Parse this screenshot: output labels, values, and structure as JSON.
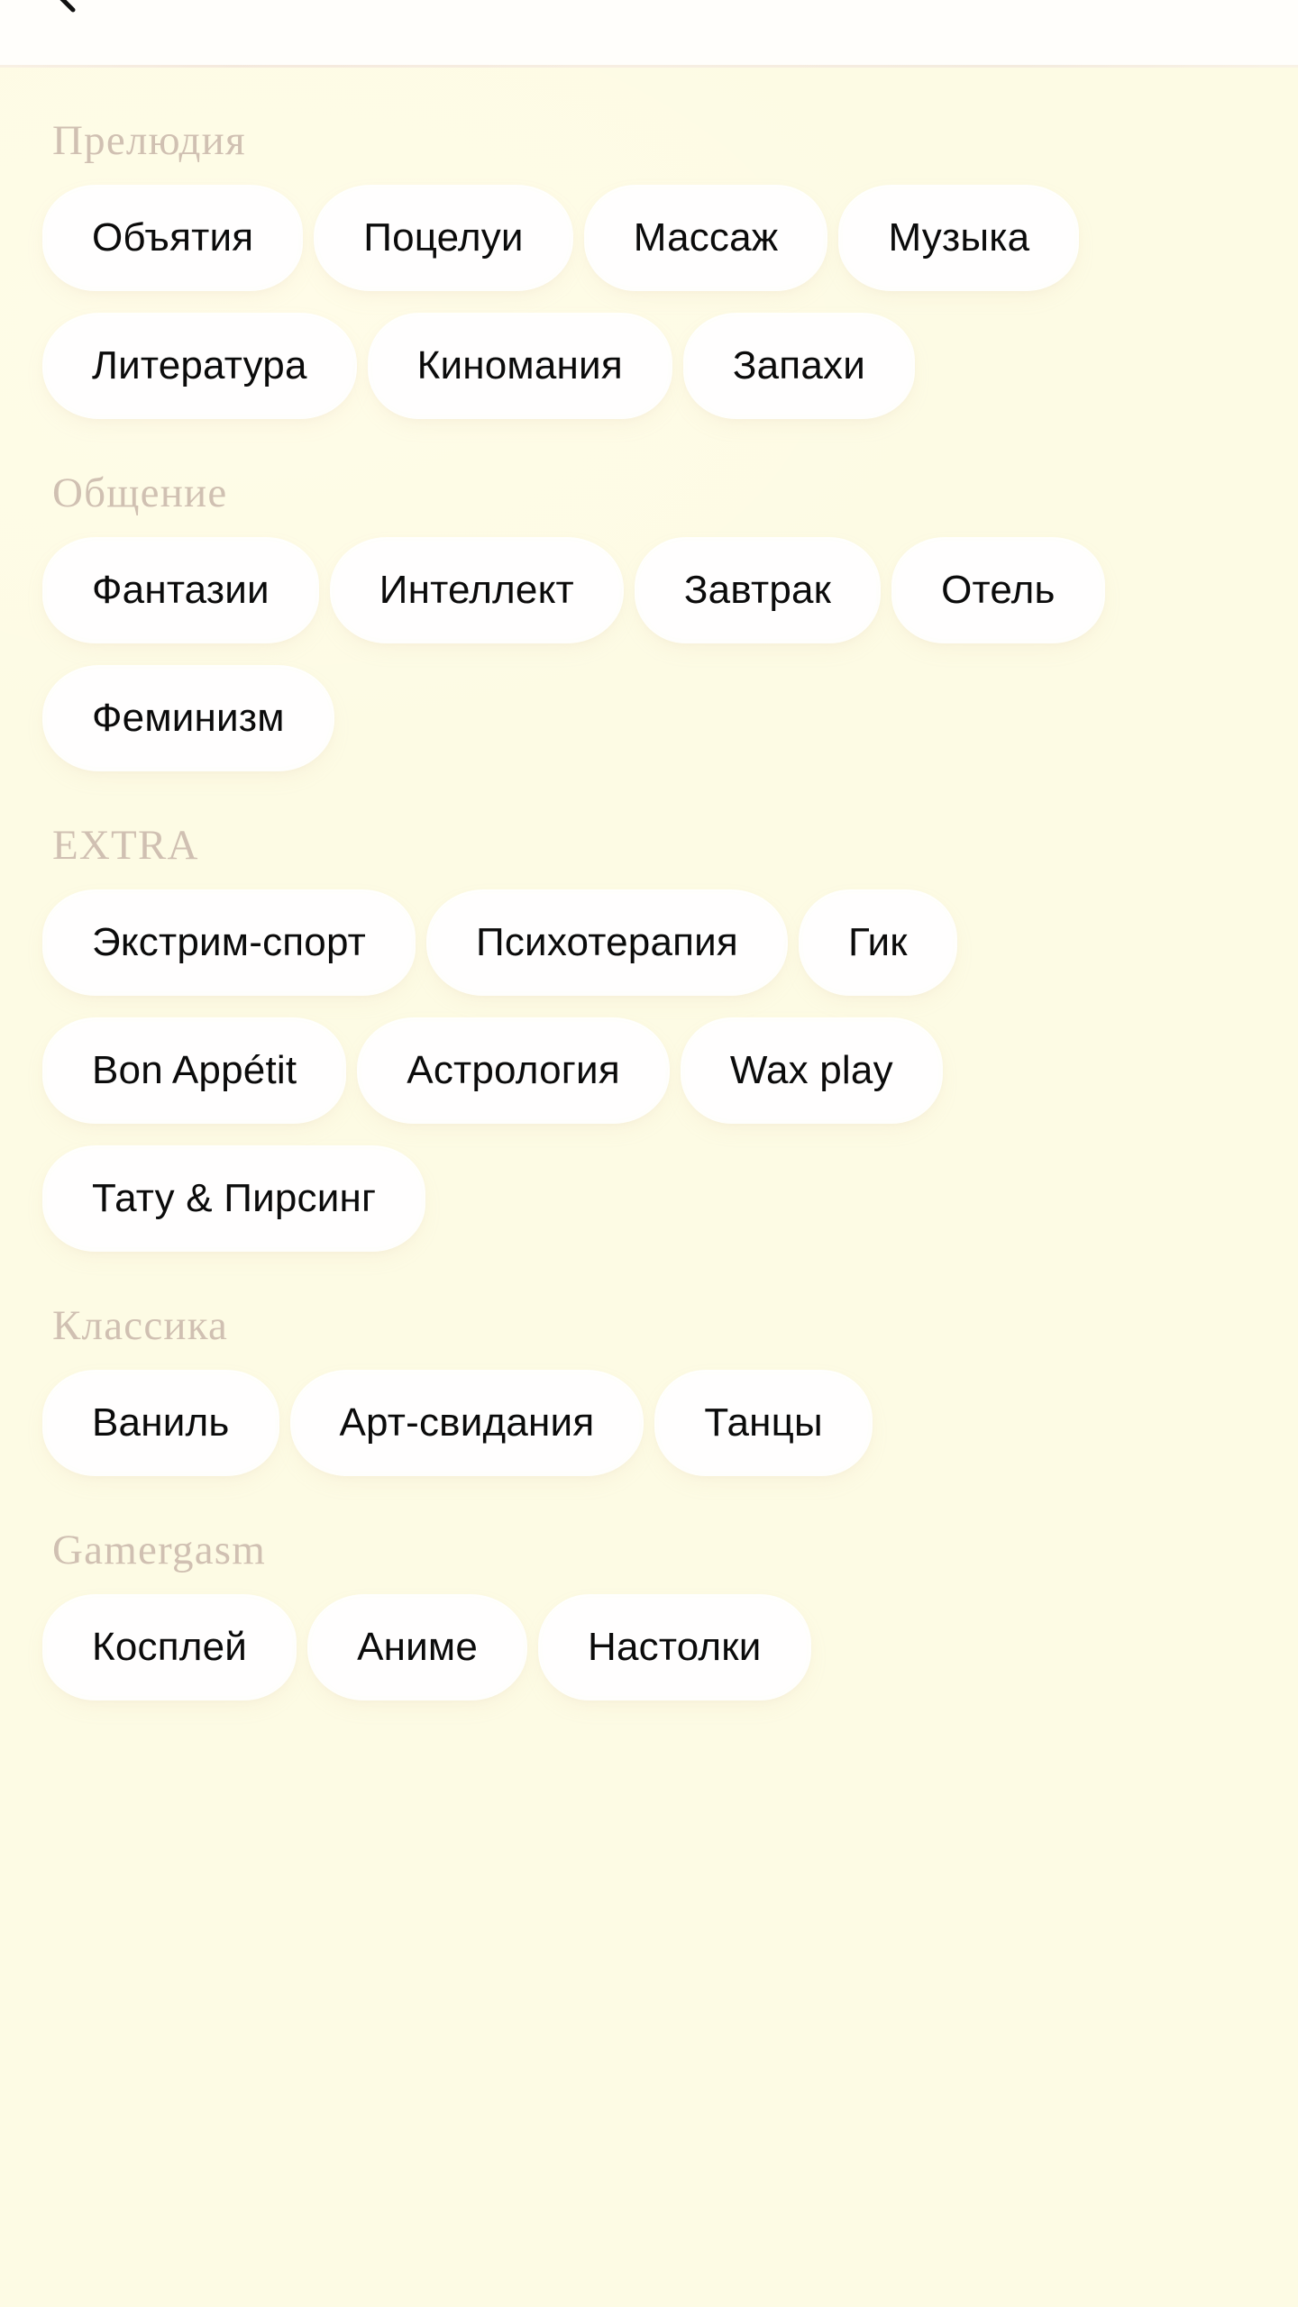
{
  "header": {
    "back_icon": "chevron-left-icon"
  },
  "theme": {
    "page_background": "#fdfbe4",
    "topbar_background": "#fffefb",
    "chip_background": "#fffefe",
    "chip_edge": "#f0cdb6",
    "section_title_color": "#cdbcae",
    "chip_text_color": "#0b0b0b"
  },
  "sections": [
    {
      "title": "Прелюдия",
      "chips": [
        "Объятия",
        "Поцелуи",
        "Массаж",
        "Музыка",
        "Литература",
        "Киномания",
        "Запахи"
      ]
    },
    {
      "title": "Общение",
      "chips": [
        "Фантазии",
        "Интеллект",
        "Завтрак",
        "Отель",
        "Феминизм"
      ]
    },
    {
      "title": "EXTRA",
      "chips": [
        "Экстрим-спорт",
        "Психотерапия",
        "Гик",
        "Bon Appétit",
        "Астрология",
        "Wax play",
        "Тату & Пирсинг"
      ]
    },
    {
      "title": "Классика",
      "chips": [
        "Ваниль",
        "Арт-свидания",
        "Танцы"
      ]
    },
    {
      "title": "Gamergasm",
      "chips": [
        "Косплей",
        "Аниме",
        "Настолки"
      ]
    }
  ]
}
